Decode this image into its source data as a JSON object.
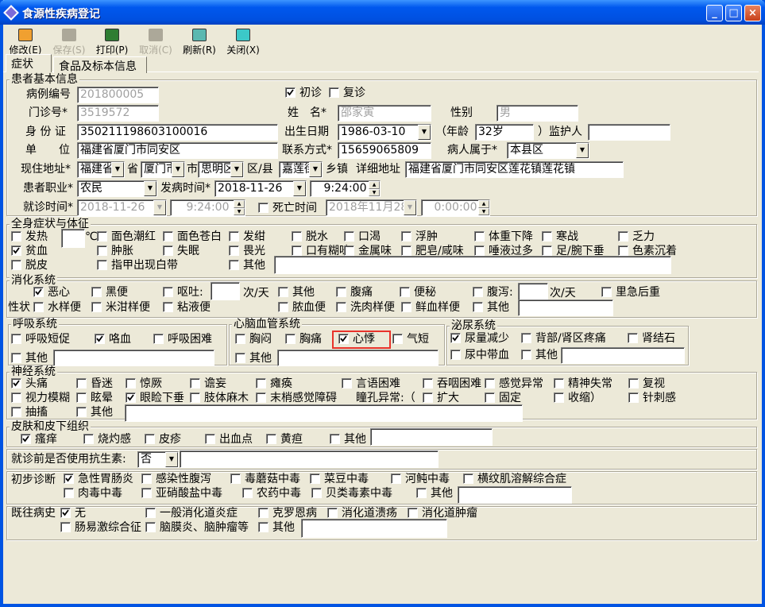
{
  "window": {
    "title": "食源性疾病登记",
    "controls": {
      "minimize": "_",
      "maximize": "□",
      "close": "×"
    }
  },
  "toolbar": [
    {
      "label": "修改(E)",
      "enabled": true,
      "icon": "edit-icon",
      "color": "#F0A030"
    },
    {
      "label": "保存(S)",
      "enabled": false,
      "icon": "save-icon",
      "color": "#ACA899"
    },
    {
      "label": "打印(P)",
      "enabled": true,
      "icon": "print-icon",
      "color": "#2E7D32"
    },
    {
      "label": "取消(C)",
      "enabled": false,
      "icon": "cancel-icon",
      "color": "#ACA899"
    },
    {
      "label": "刷新(R)",
      "enabled": true,
      "icon": "refresh-icon",
      "color": "#5BB8B0"
    },
    {
      "label": "关闭(X)",
      "enabled": true,
      "icon": "close-icon",
      "color": "#3CC8C8"
    }
  ],
  "tabs": [
    {
      "label": "症状",
      "active": true
    },
    {
      "label": "食品及标本信息",
      "active": false
    }
  ],
  "basic": {
    "title": "患者基本信息",
    "case_no_label": "病例编号",
    "case_no": "201800005",
    "first_visit": {
      "label": "初诊",
      "checked": true
    },
    "revisit": {
      "label": "复诊",
      "checked": false
    },
    "outpatient_label": "门诊号*",
    "outpatient": "3519572",
    "name_label": "姓　名*",
    "name": "邵家寅",
    "gender_label": "性别",
    "gender": "男",
    "id_label": "身 份 证",
    "id": "350211198603100016",
    "birth_label": "出生日期",
    "birth": "1986-03-10",
    "age_prefix": "（年龄",
    "age": "32岁",
    "guardian_label": "）监护人",
    "guardian": "",
    "employer_label": "单　　位",
    "employer": "福建省厦门市同安区",
    "phone_label": "联系方式*",
    "phone": "15659065809",
    "belongs_label": "病人属于*",
    "belongs": "本县区",
    "address_label": "现住地址*",
    "province": "福建省",
    "province_suffix": "省",
    "city": "厦门市",
    "city_suffix": "市",
    "district": "思明区",
    "district_suffix": "区/县",
    "town": "嘉莲街",
    "town_suffix": "乡镇",
    "detail_label": "详细地址",
    "detail": "福建省厦门市同安区莲花镇莲花镇",
    "occupation_label": "患者职业*",
    "occupation": "农民",
    "onset_label": "发病时间*",
    "onset_date": "2018-11-26",
    "onset_time": "9:24:00",
    "visit_label": "就诊时间*",
    "visit_date": "2018-11-26",
    "visit_time": "9:24:00",
    "death": {
      "label": "死亡时间",
      "checked": false
    },
    "death_date": "2018年11月28",
    "death_time": "0:00:00"
  },
  "general": {
    "title": "全身症状与体征",
    "fever_value": "",
    "fever_unit": "℃",
    "other_text": "",
    "items": [
      {
        "label": "发热",
        "checked": false
      },
      {
        "label": "面色潮红",
        "checked": false
      },
      {
        "label": "面色苍白",
        "checked": false
      },
      {
        "label": "发绀",
        "checked": false
      },
      {
        "label": "脱水",
        "checked": false
      },
      {
        "label": "口渴",
        "checked": false
      },
      {
        "label": "浮肿",
        "checked": false
      },
      {
        "label": "体重下降",
        "checked": false
      },
      {
        "label": "寒战",
        "checked": false
      },
      {
        "label": "乏力",
        "checked": false
      },
      {
        "label": "贫血",
        "checked": true
      },
      {
        "label": "肿胀",
        "checked": false
      },
      {
        "label": "失眠",
        "checked": false
      },
      {
        "label": "畏光",
        "checked": false
      },
      {
        "label": "口有糊味",
        "checked": false
      },
      {
        "label": "金属味",
        "checked": false
      },
      {
        "label": "肥皂/咸味",
        "checked": false
      },
      {
        "label": "唾液过多",
        "checked": false
      },
      {
        "label": "足/腕下垂",
        "checked": false
      },
      {
        "label": "色素沉着",
        "checked": false
      },
      {
        "label": "脱皮",
        "checked": false
      },
      {
        "label": "指甲出现白带",
        "checked": false
      },
      {
        "label": "其他",
        "checked": false
      }
    ]
  },
  "digestive": {
    "title": "消化系统",
    "vomit_count": "",
    "per_day": "次/天",
    "diarrhea_count": "",
    "per_day2": "次/天",
    "stool_label": "性状",
    "other_text": "",
    "items": [
      {
        "label": "恶心",
        "checked": true
      },
      {
        "label": "黑便",
        "checked": false
      },
      {
        "label": "呕吐:",
        "checked": false
      },
      {
        "label": "其他",
        "checked": false
      },
      {
        "label": "腹痛",
        "checked": false
      },
      {
        "label": "便秘",
        "checked": false
      },
      {
        "label": "腹泻:",
        "checked": false
      },
      {
        "label": "里急后重",
        "checked": false
      },
      {
        "label": "水样便",
        "checked": false
      },
      {
        "label": "米泔样便",
        "checked": false
      },
      {
        "label": "粘液便",
        "checked": false
      },
      {
        "label": "脓血便",
        "checked": false
      },
      {
        "label": "洗肉样便",
        "checked": false
      },
      {
        "label": "鲜血样便",
        "checked": false
      },
      {
        "label": "其他",
        "checked": false
      }
    ]
  },
  "respiratory": {
    "title": "呼吸系统",
    "other_text": "",
    "items": [
      {
        "label": "呼吸短促",
        "checked": false
      },
      {
        "label": "咯血",
        "checked": true
      },
      {
        "label": "呼吸困难",
        "checked": false
      },
      {
        "label": "其他",
        "checked": false
      }
    ]
  },
  "cardio": {
    "title": "心脑血管系统",
    "other_text": "",
    "items": [
      {
        "label": "胸闷",
        "checked": false
      },
      {
        "label": "胸痛",
        "checked": false
      },
      {
        "label": "心悸",
        "checked": true
      },
      {
        "label": "气短",
        "checked": false
      },
      {
        "label": "其他",
        "checked": false
      }
    ]
  },
  "urinary": {
    "title": "泌尿系统",
    "other_text": "",
    "items": [
      {
        "label": "尿量减少",
        "checked": true
      },
      {
        "label": "背部/肾区疼痛",
        "checked": false
      },
      {
        "label": "肾结石",
        "checked": false
      },
      {
        "label": "尿中带血",
        "checked": false
      },
      {
        "label": "其他",
        "checked": false
      }
    ]
  },
  "neuro": {
    "title": "神经系统",
    "other_text": "",
    "pupil_label": "瞳孔异常:（",
    "items": [
      {
        "label": "头痛",
        "checked": true
      },
      {
        "label": "昏迷",
        "checked": false
      },
      {
        "label": "惊厥",
        "checked": false
      },
      {
        "label": "谵妄",
        "checked": false
      },
      {
        "label": "瘫痪",
        "checked": false
      },
      {
        "label": "言语困难",
        "checked": false
      },
      {
        "label": "吞咽困难",
        "checked": false
      },
      {
        "label": "感觉异常",
        "checked": false
      },
      {
        "label": "精神失常",
        "checked": false
      },
      {
        "label": "复视",
        "checked": false
      },
      {
        "label": "视力模糊",
        "checked": false
      },
      {
        "label": "眩晕",
        "checked": false
      },
      {
        "label": "眼睑下垂",
        "checked": true
      },
      {
        "label": "肢体麻木",
        "checked": false
      },
      {
        "label": "末梢感觉障碍",
        "checked": false
      },
      {
        "label": "扩大",
        "checked": false
      },
      {
        "label": "固定",
        "checked": false
      },
      {
        "label": "收缩）",
        "checked": false
      },
      {
        "label": "针刺感",
        "checked": false
      },
      {
        "label": "抽搐",
        "checked": false
      },
      {
        "label": "其他",
        "checked": false
      }
    ]
  },
  "skin": {
    "title": "皮肤和皮下组织",
    "other_text": "",
    "items": [
      {
        "label": "瘙痒",
        "checked": true
      },
      {
        "label": "烧灼感",
        "checked": false
      },
      {
        "label": "皮疹",
        "checked": false
      },
      {
        "label": "出血点",
        "checked": false
      },
      {
        "label": "黄疸",
        "checked": false
      },
      {
        "label": "其他",
        "checked": false
      }
    ]
  },
  "antibiotics": {
    "label": "就诊前是否使用抗生素:",
    "value": "否",
    "detail": ""
  },
  "diagnosis": {
    "label": "初步诊断",
    "other_text": "",
    "items": [
      {
        "label": "急性胃肠炎",
        "checked": true
      },
      {
        "label": "感染性腹泻",
        "checked": false
      },
      {
        "label": "毒蘑菇中毒",
        "checked": false
      },
      {
        "label": "菜豆中毒",
        "checked": false
      },
      {
        "label": "河鲀中毒",
        "checked": false
      },
      {
        "label": "横纹肌溶解综合症",
        "checked": false
      },
      {
        "label": "肉毒中毒",
        "checked": false
      },
      {
        "label": "亚硝酸盐中毒",
        "checked": false
      },
      {
        "label": "农药中毒",
        "checked": false
      },
      {
        "label": "贝类毒素中毒",
        "checked": false
      },
      {
        "label": "其他",
        "checked": false
      }
    ]
  },
  "history": {
    "label": "既往病史",
    "other_text": "",
    "items": [
      {
        "label": "无",
        "checked": true
      },
      {
        "label": "一般消化道炎症",
        "checked": false
      },
      {
        "label": "克罗恩病",
        "checked": false
      },
      {
        "label": "消化道溃疡",
        "checked": false
      },
      {
        "label": "消化道肿瘤",
        "checked": false
      },
      {
        "label": "肠易激综合征",
        "checked": false
      },
      {
        "label": "脑膜炎、脑肿瘤等",
        "checked": false
      },
      {
        "label": "其他",
        "checked": false
      }
    ]
  }
}
